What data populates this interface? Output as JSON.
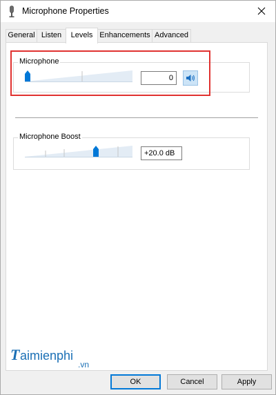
{
  "window": {
    "title": "Microphone Properties",
    "icon": "microphone-icon"
  },
  "tabs": [
    {
      "label": "General",
      "active": false
    },
    {
      "label": "Listen",
      "active": false
    },
    {
      "label": "Levels",
      "active": true
    },
    {
      "label": "Enhancements",
      "active": false
    },
    {
      "label": "Advanced",
      "active": false
    }
  ],
  "levels": {
    "microphone": {
      "label": "Microphone",
      "value": "0",
      "level_fraction": 0.0,
      "mute_icon": "speaker-icon"
    },
    "boost": {
      "label": "Microphone Boost",
      "value": "+20.0 dB",
      "level_fraction": 0.67
    }
  },
  "watermark": {
    "logo_text": "Taimienphi",
    "suffix": ".vn"
  },
  "buttons": {
    "ok": "OK",
    "cancel": "Cancel",
    "apply": "Apply"
  },
  "colors": {
    "thumb": "#0078d7",
    "highlight": "#e0312f",
    "watermark": "#1a6fb5"
  }
}
